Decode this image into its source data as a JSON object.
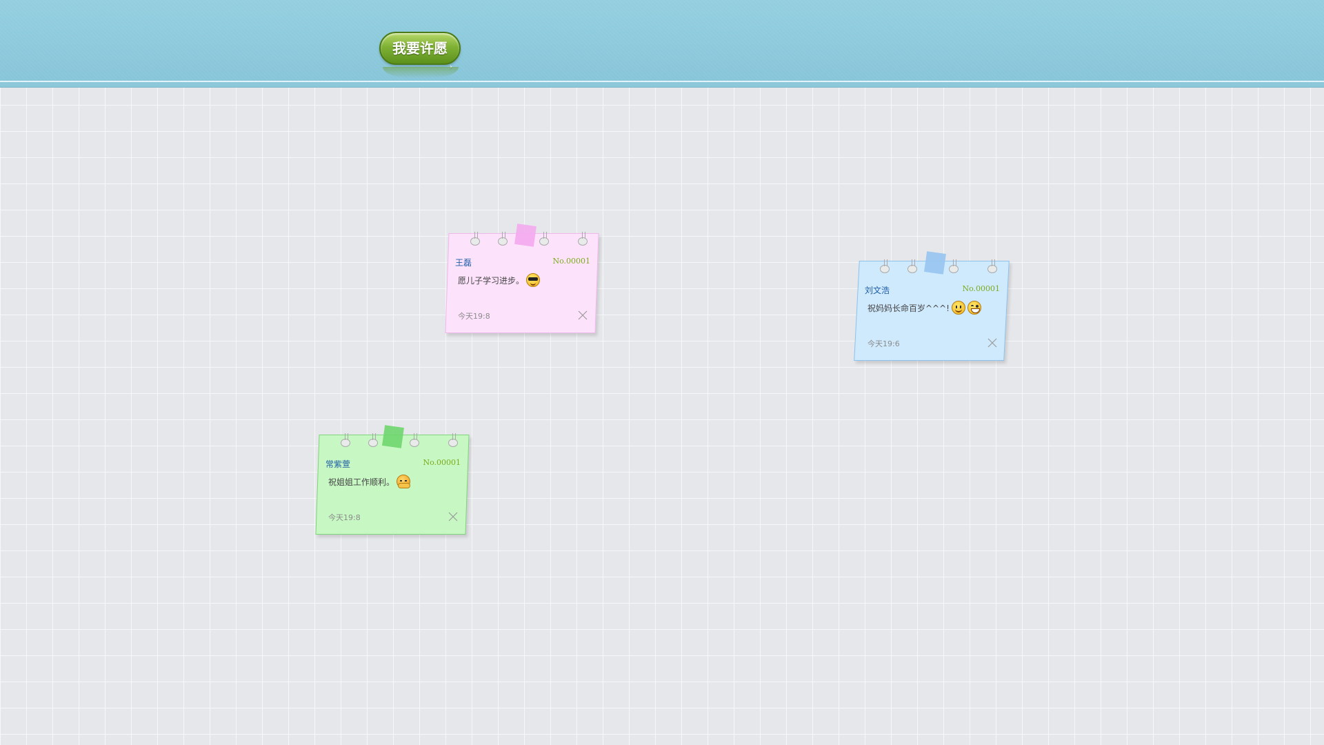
{
  "header": {
    "wish_button_label": "我要许愿",
    "wish_button_arrow": "›"
  },
  "notes": [
    {
      "color": "pink",
      "name": "王磊",
      "number": "No.00001",
      "message": "愿儿子学习进步。",
      "emoticons": [
        "cool-face-emoji"
      ],
      "time": "今天19:8"
    },
    {
      "color": "blue",
      "name": "刘文浩",
      "number": "No.00001",
      "message": "祝妈妈长命百岁^^^!",
      "emoticons": [
        "smile-emoji",
        "grin-emoji"
      ],
      "time": "今天19:6"
    },
    {
      "color": "green",
      "name": "常紫萱",
      "number": "No.00001",
      "message": "祝姐姐工作顺利。",
      "emoticons": [
        "hug-emoji"
      ],
      "time": "今天19:8"
    }
  ],
  "colors": {
    "header": "#8cc9dc",
    "background": "#e6e7ea",
    "button": "#7fb135",
    "pink_note": "#fde2fb",
    "blue_note": "#cfe9fd",
    "green_note": "#c7f7c3",
    "name_text": "#1e5ea8",
    "number_text": "#7bab1a"
  }
}
